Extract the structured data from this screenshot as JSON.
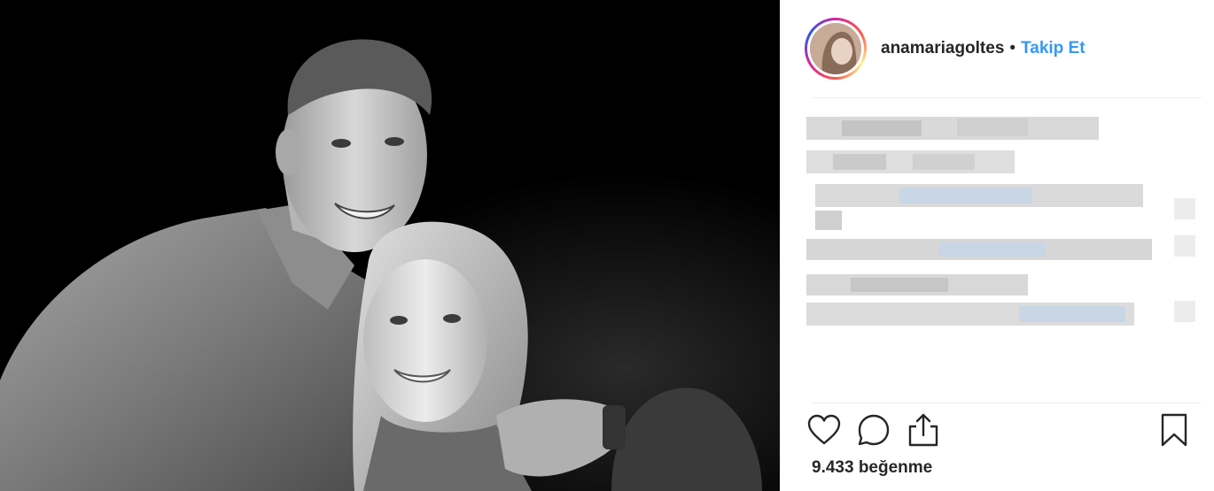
{
  "post": {
    "username": "anamariagoltes",
    "separator": "•",
    "follow_label": "Takip Et",
    "likes_text": "9.433 beğenme"
  },
  "icons": {
    "like": "heart-icon",
    "comment": "comment-bubble-icon",
    "share": "share-upload-icon",
    "save": "bookmark-icon"
  },
  "colors": {
    "link_blue": "#3897f0",
    "text_dark": "#262626",
    "divider": "#efefef"
  }
}
